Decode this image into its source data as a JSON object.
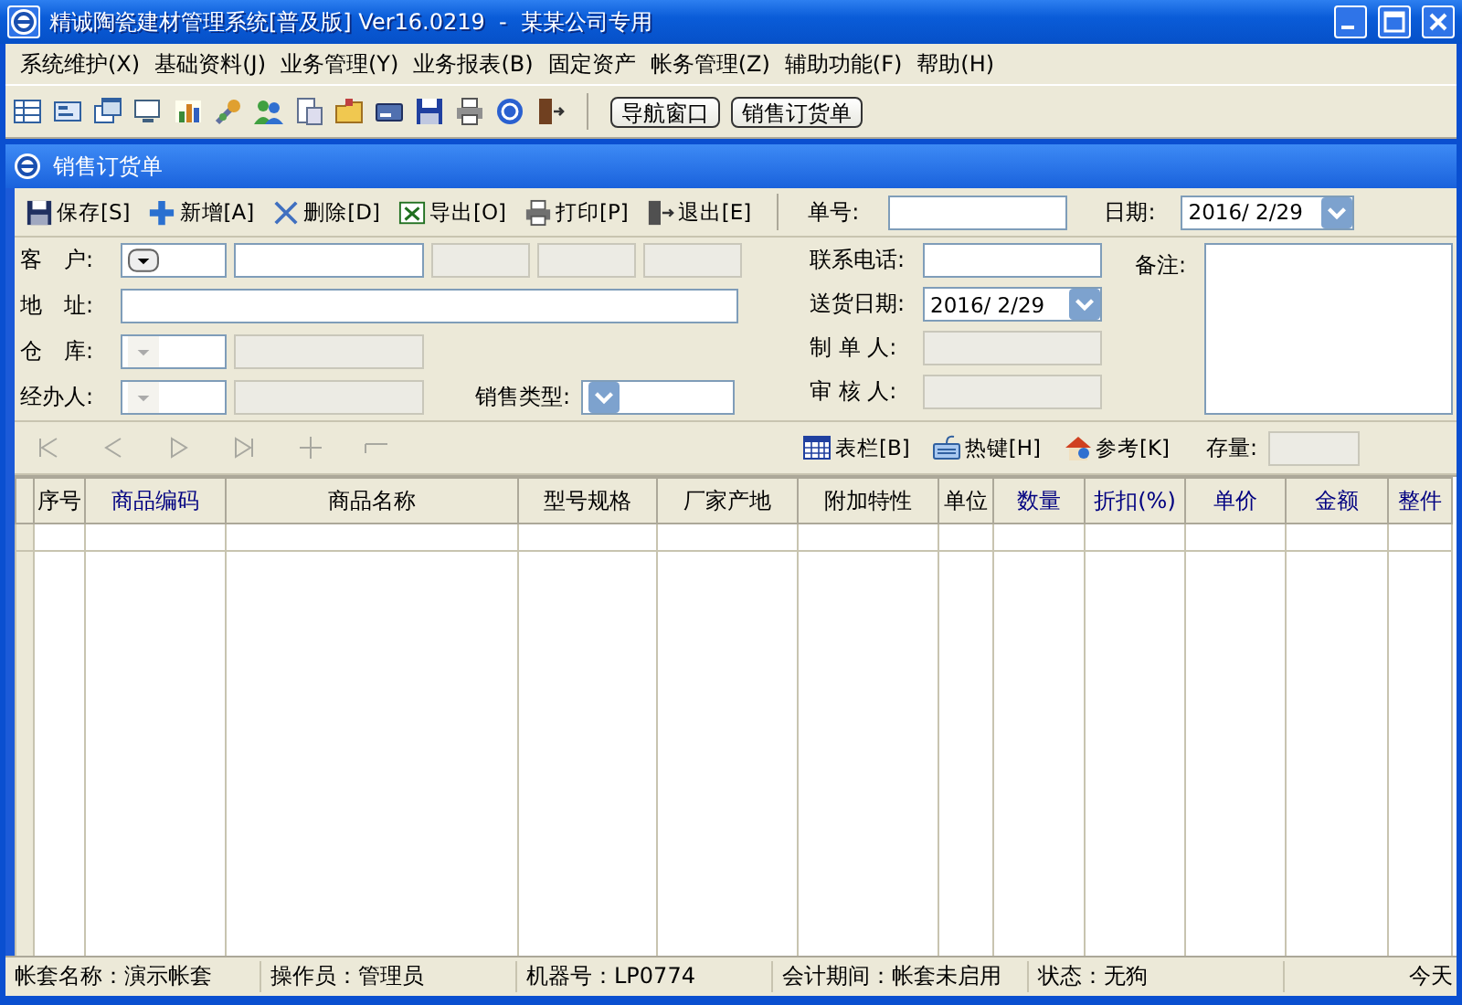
{
  "window": {
    "title": "精诚陶瓷建材管理系统[普及版] Ver16.0219  -  某某公司专用"
  },
  "menu": [
    {
      "label": "系统维护(X)"
    },
    {
      "label": "基础资料(J)"
    },
    {
      "label": "业务管理(Y)"
    },
    {
      "label": "业务报表(B)"
    },
    {
      "label": "固定资产"
    },
    {
      "label": "帐务管理(Z)"
    },
    {
      "label": "辅助功能(F)"
    },
    {
      "label": "帮助(H)"
    }
  ],
  "toolbar": {
    "buttons": [
      "导航窗口",
      "销售订货单"
    ]
  },
  "document": {
    "title": "销售订货单",
    "actions": [
      {
        "label": "保存[S]",
        "kind": "save"
      },
      {
        "label": "新增[A]",
        "kind": "add"
      },
      {
        "label": "删除[D]",
        "kind": "delete"
      },
      {
        "label": "导出[O]",
        "kind": "export"
      },
      {
        "label": "打印[P]",
        "kind": "print"
      },
      {
        "label": "退出[E]",
        "kind": "exit"
      }
    ],
    "number_label": "单号:",
    "date_label": "日期:",
    "date": "2016/ 2/29"
  },
  "form": {
    "customer": {
      "label": "客　户:"
    },
    "customer_extras": [
      {
        "disabled": true
      },
      {
        "disabled": true
      },
      {
        "disabled": true
      }
    ],
    "address": {
      "label": "地　址:"
    },
    "warehouse": {
      "label": "仓　库:",
      "disabled": true
    },
    "handler": {
      "label": "经办人:",
      "disabled": true
    },
    "sales_type": {
      "label": "销售类型:"
    },
    "phone": {
      "label": "联系电话:"
    },
    "delivery_date": {
      "label": "送货日期:",
      "value": "2016/ 2/29"
    },
    "maker": {
      "label": "制 单 人:",
      "disabled": true
    },
    "reviewer": {
      "label": "审 核 人:",
      "disabled": true
    },
    "note": {
      "label": "备注:"
    }
  },
  "nav_buttons": [
    {
      "kind": "first",
      "disabled": true
    },
    {
      "kind": "prev",
      "disabled": true
    },
    {
      "kind": "next",
      "disabled": true
    },
    {
      "kind": "last",
      "disabled": true
    },
    {
      "kind": "insert",
      "disabled": true
    },
    {
      "kind": "remove",
      "disabled": true
    }
  ],
  "tools": [
    {
      "label": "表栏[B]",
      "kind": "columns"
    },
    {
      "label": "热键[H]",
      "kind": "hotkeys"
    },
    {
      "label": "参考[K]",
      "kind": "reference"
    }
  ],
  "stock_label": "存量:",
  "table": {
    "columns": [
      {
        "label": "序号",
        "color": "#000000"
      },
      {
        "label": "商品编码",
        "color": "#000080"
      },
      {
        "label": "商品名称",
        "color": "#000000"
      },
      {
        "label": "型号规格",
        "color": "#000000"
      },
      {
        "label": "厂家产地",
        "color": "#000000"
      },
      {
        "label": "附加特性",
        "color": "#000000"
      },
      {
        "label": "单位",
        "color": "#000000"
      },
      {
        "label": "数量",
        "color": "#000080"
      },
      {
        "label": "折扣(%)",
        "color": "#000080"
      },
      {
        "label": "单价",
        "color": "#000080"
      },
      {
        "label": "金额",
        "color": "#000080"
      },
      {
        "label": "整件",
        "color": "#000080"
      }
    ]
  },
  "status_bar": [
    "帐套名称：演示帐套",
    "操作员：管理员",
    "机器号：LP0774",
    "会计期间：帐套未启用",
    "状态：无狗",
    "今天"
  ]
}
